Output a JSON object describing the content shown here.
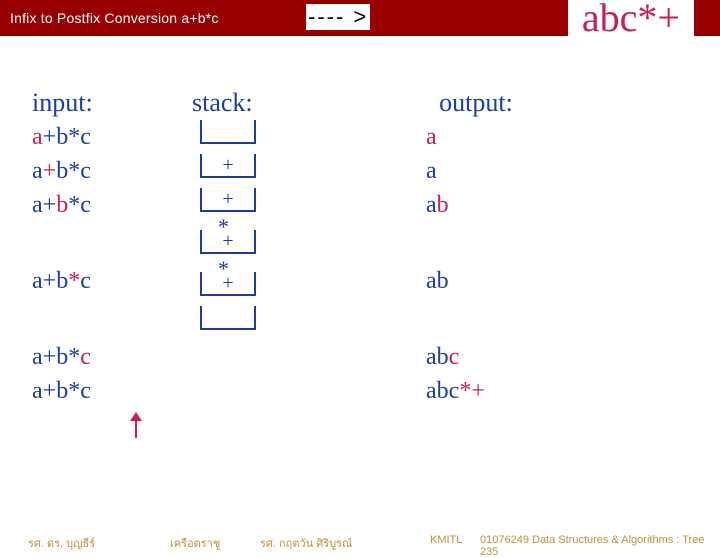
{
  "titlebar": {
    "left": "Infix to Postfix Conversion  a+b*c",
    "arrow": "---- >",
    "result": "abc*+"
  },
  "headers": {
    "input": "input:",
    "stack": "stack:",
    "output": "output:"
  },
  "rows": {
    "in1_pre": "",
    "in1_mark": "a",
    "in1_post": "+b*c",
    "in2_pre": "a",
    "in2_mark": "+",
    "in2_post": "b*c",
    "in3_pre": "a+",
    "in3_mark": "b",
    "in3_post": "*c",
    "in4_pre": "a+b",
    "in4_mark": "*",
    "in4_post": "c",
    "in5_pre": "a+b*",
    "in5_mark": "c",
    "in5_post": "",
    "in6_pre": "a+b*c",
    "in6_mark": "",
    "in6_post": "",
    "st1": "",
    "st2": "+",
    "st3": "+",
    "st3b": "*",
    "st4": "+",
    "st4b": "*",
    "st5": "+",
    "st6": "",
    "out1": "a",
    "out2": "a",
    "out3_a": "a",
    "out3_b": "b",
    "out4_a": "a",
    "out4_b": "b",
    "out5_a": "ab",
    "out5_b": "c",
    "out6_a": "abc",
    "out6_b": "*+"
  },
  "footer": {
    "a": "รศ. ดร. บุญธีร์",
    "b": "เครือตราชู",
    "c": "รศ. กฤตวัน  ศิริบูรณ์",
    "d": "KMITL",
    "e": "01076249 Data Structures & Algorithms : Tree 235"
  }
}
